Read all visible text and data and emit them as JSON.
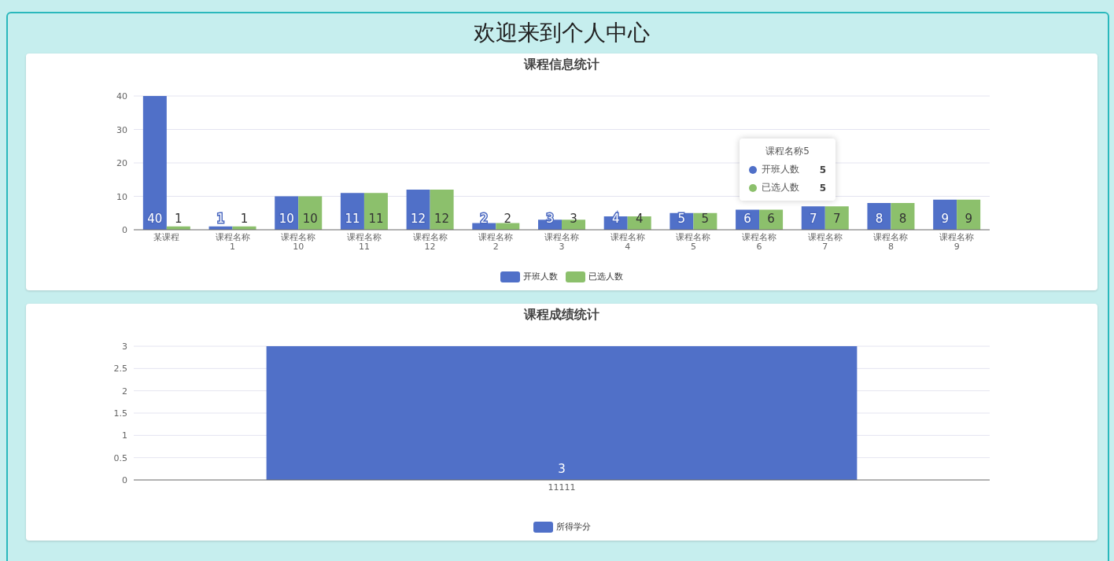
{
  "page_title": "欢迎来到个人中心",
  "cards": [
    {
      "title": "课程信息统计",
      "chart_data": {
        "type": "bar",
        "categories": [
          "某课程",
          "课程名称1",
          "课程名称10",
          "课程名称11",
          "课程名称12",
          "课程名称2",
          "课程名称3",
          "课程名称4",
          "课程名称5",
          "课程名称6",
          "课程名称7",
          "课程名称8",
          "课程名称9"
        ],
        "series": [
          {
            "name": "开班人数",
            "color": "#5070c8",
            "values": [
              40,
              1,
              10,
              11,
              12,
              2,
              3,
              4,
              5,
              6,
              7,
              8,
              9
            ]
          },
          {
            "name": "已选人数",
            "color": "#8cc06c",
            "values": [
              1,
              1,
              10,
              11,
              12,
              2,
              3,
              4,
              5,
              6,
              7,
              8,
              9
            ]
          }
        ],
        "ylim": [
          0,
          40
        ],
        "yticks": [
          0,
          10,
          20,
          30,
          40
        ],
        "grid": true,
        "data_labels": true
      },
      "tooltip": {
        "title": "课程名称5",
        "rows": [
          {
            "name": "开班人数",
            "value": "5",
            "color": "#5070c8"
          },
          {
            "name": "已选人数",
            "value": "5",
            "color": "#8cc06c"
          }
        ]
      }
    },
    {
      "title": "课程成绩统计",
      "chart_data": {
        "type": "bar",
        "categories": [
          "11111"
        ],
        "series": [
          {
            "name": "所得学分",
            "color": "#5070c8",
            "values": [
              3
            ]
          }
        ],
        "ylim": [
          0,
          3
        ],
        "yticks": [
          0,
          0.5,
          1,
          1.5,
          2,
          2.5,
          3
        ],
        "grid": true,
        "data_labels": true
      }
    }
  ]
}
